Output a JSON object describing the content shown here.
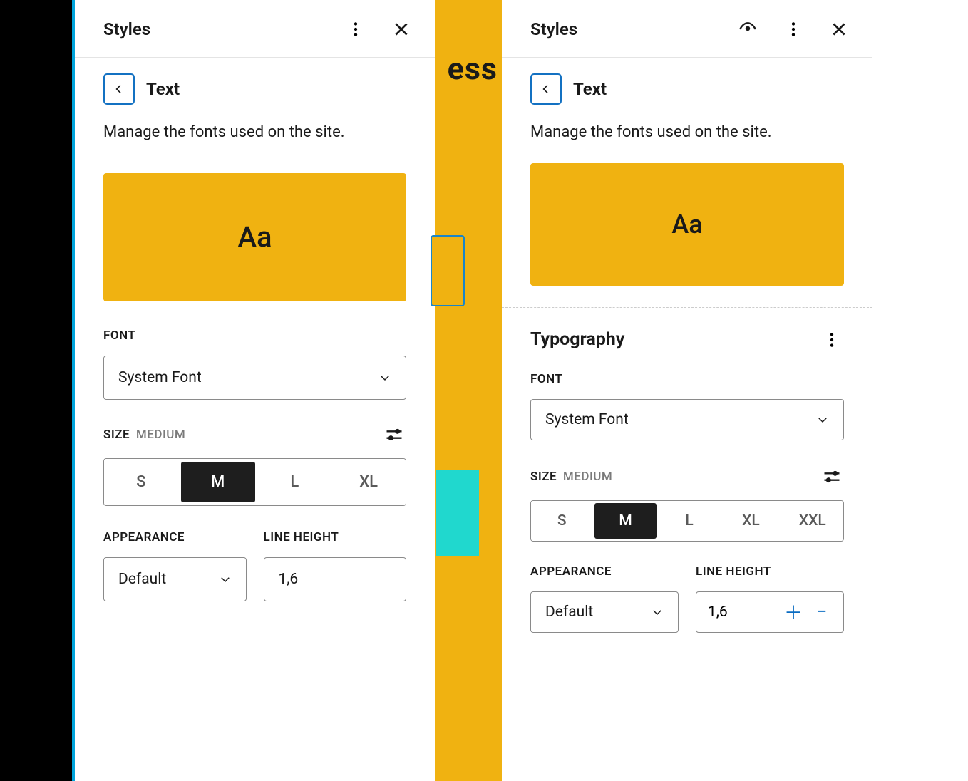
{
  "bg": {
    "text_fragment": "ess"
  },
  "left": {
    "header_title": "Styles",
    "crumb": "Text",
    "description": "Manage the fonts used on the site.",
    "preview": "Aa",
    "font_label": "FONT",
    "font_value": "System Font",
    "size_label": "SIZE",
    "size_sub": "MEDIUM",
    "sizes": [
      "S",
      "M",
      "L",
      "XL"
    ],
    "size_active": "M",
    "appearance_label": "APPEARANCE",
    "appearance_value": "Default",
    "lineheight_label": "LINE HEIGHT",
    "lineheight_value": "1,6"
  },
  "right": {
    "header_title": "Styles",
    "crumb": "Text",
    "description": "Manage the fonts used on the site.",
    "preview": "Aa",
    "typography_title": "Typography",
    "font_label": "FONT",
    "font_value": "System Font",
    "size_label": "SIZE",
    "size_sub": "MEDIUM",
    "sizes": [
      "S",
      "M",
      "L",
      "XL",
      "XXL"
    ],
    "size_active": "M",
    "appearance_label": "APPEARANCE",
    "appearance_value": "Default",
    "lineheight_label": "LINE HEIGHT",
    "lineheight_value": "1,6"
  }
}
